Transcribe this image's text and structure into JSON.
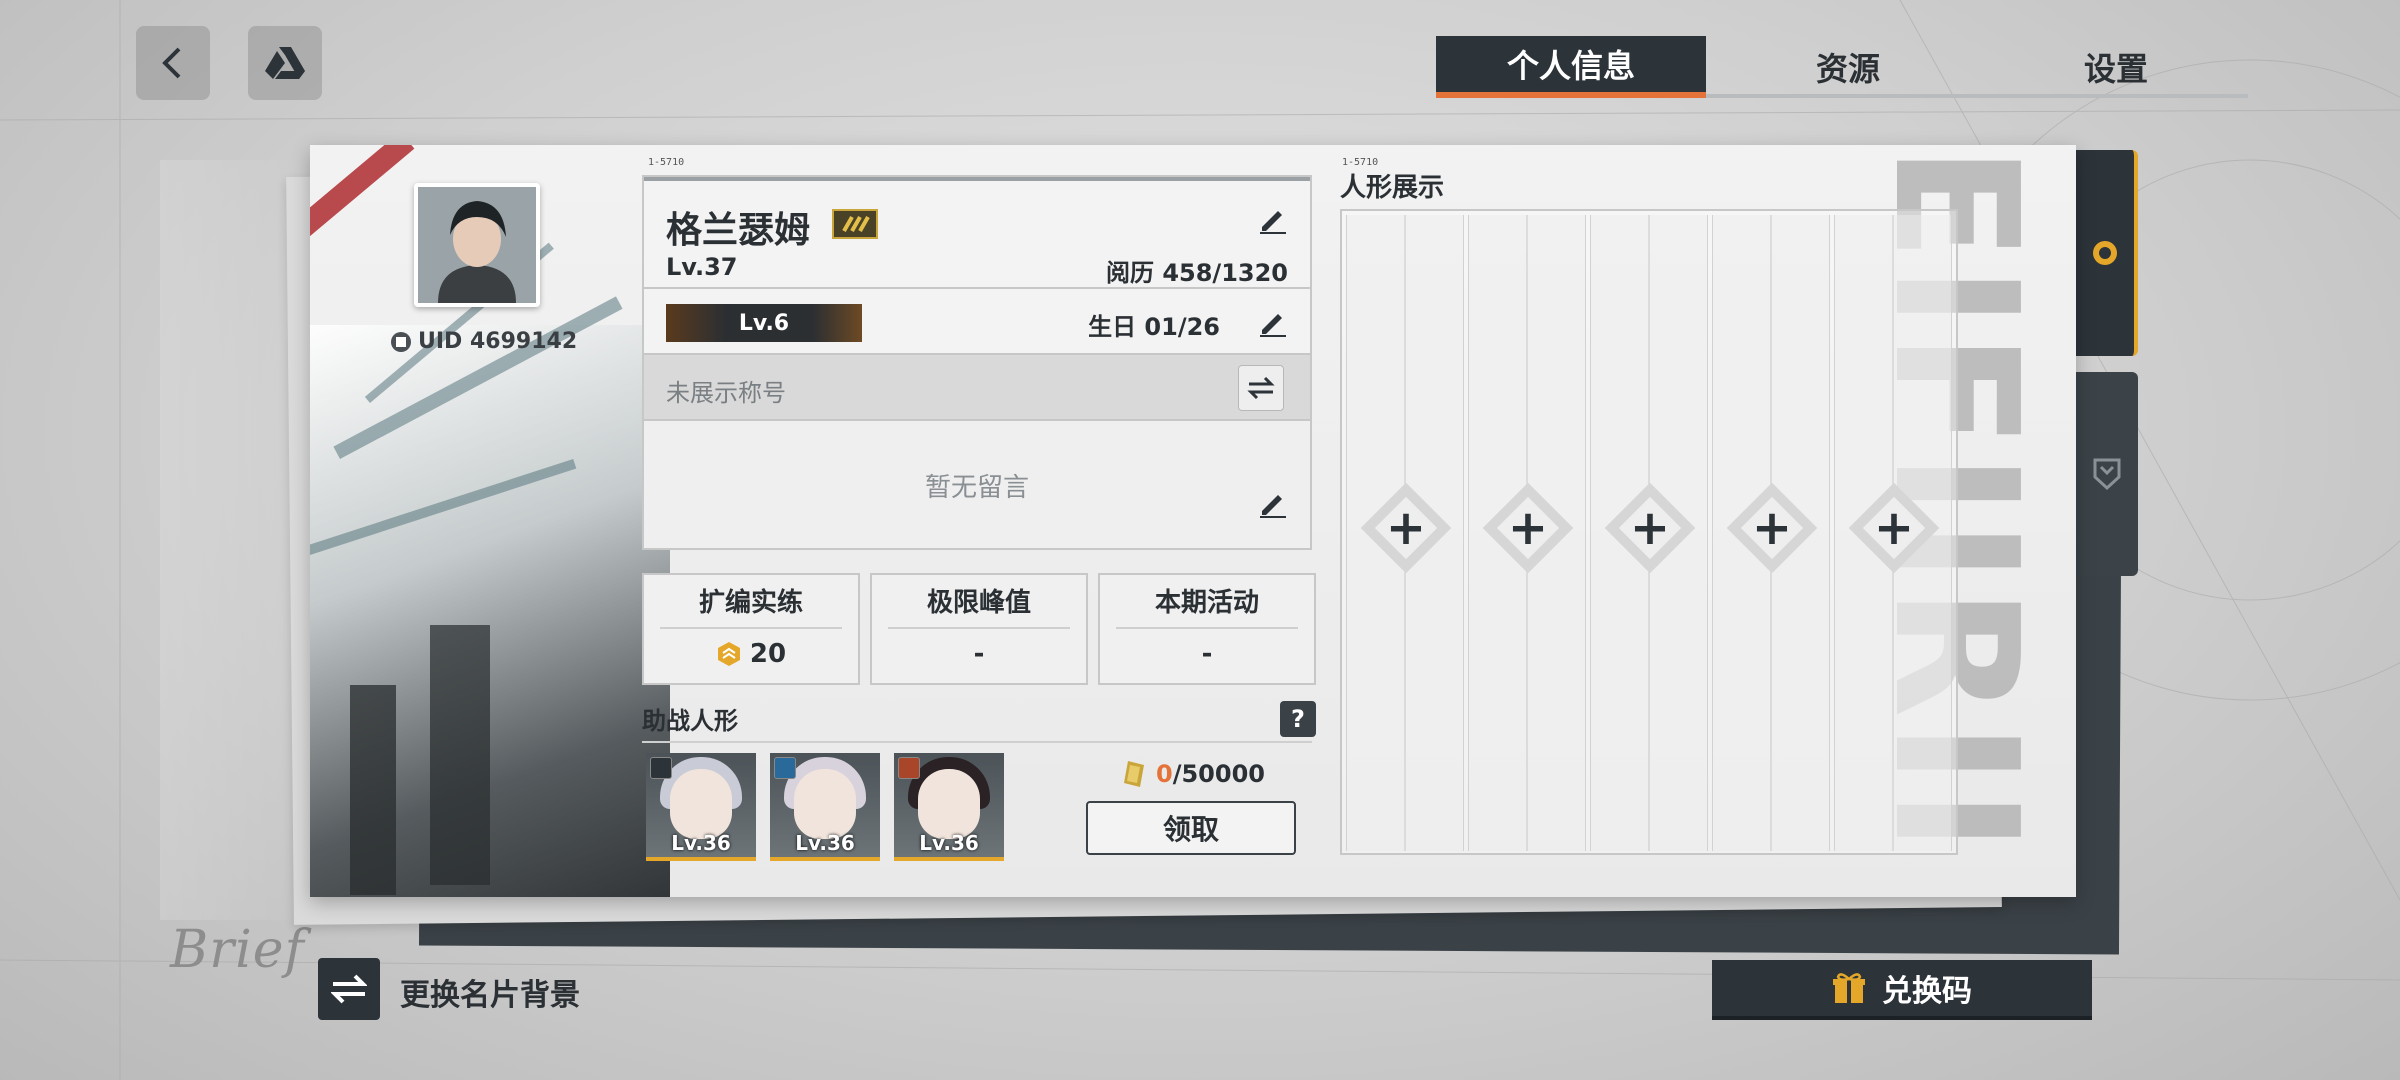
{
  "top_bar": {
    "back_icon": "chevron-left-icon",
    "drive_icon": "drive-icon",
    "tabs": [
      {
        "label": "个人信息",
        "active": true
      },
      {
        "label": "资源",
        "active": false
      },
      {
        "label": "设置",
        "active": false
      }
    ],
    "accent_color": "#e4733a"
  },
  "profile": {
    "uid_label": "UID 4699142",
    "name": "格兰瑟姆",
    "level": "Lv.37",
    "experience": "阅历 458/1320",
    "rank_badge": "Lv.6",
    "birthday": "生日 01/26",
    "title_placeholder": "未展示称号",
    "message_placeholder": "暂无留言"
  },
  "stats": [
    {
      "label": "扩编实练",
      "value": "20",
      "icon": "coin-icon"
    },
    {
      "label": "极限峰值",
      "value": "-"
    },
    {
      "label": "本期活动",
      "value": "-"
    }
  ],
  "support": {
    "label": "助战人形",
    "help_label": "?",
    "dolls": [
      {
        "level": "Lv.36",
        "hair": "#c9cbd6",
        "element_icon": "shield-element-icon"
      },
      {
        "level": "Lv.36",
        "hair": "#d7d2dc",
        "element_icon": "water-element-icon"
      },
      {
        "level": "Lv.36",
        "hair": "#2a2224",
        "element_icon": "fire-element-icon"
      }
    ],
    "reward_current": "0",
    "reward_total": "/50000",
    "claim_label": "领取"
  },
  "display": {
    "title": "人形展示",
    "slots": [
      "+",
      "+",
      "+",
      "+",
      "+"
    ]
  },
  "card_codes": {
    "left": "1-5710",
    "right": "1-5710"
  },
  "bottom": {
    "change_bg_label": "更换名片背景",
    "redeem_label": "兑换码"
  },
  "decor": {
    "watermark": "EIFIIRII",
    "brief": "Brief"
  },
  "colors": {
    "dark": "#2c3339",
    "gold": "#e4a72a",
    "stripe": "#b8494c"
  }
}
